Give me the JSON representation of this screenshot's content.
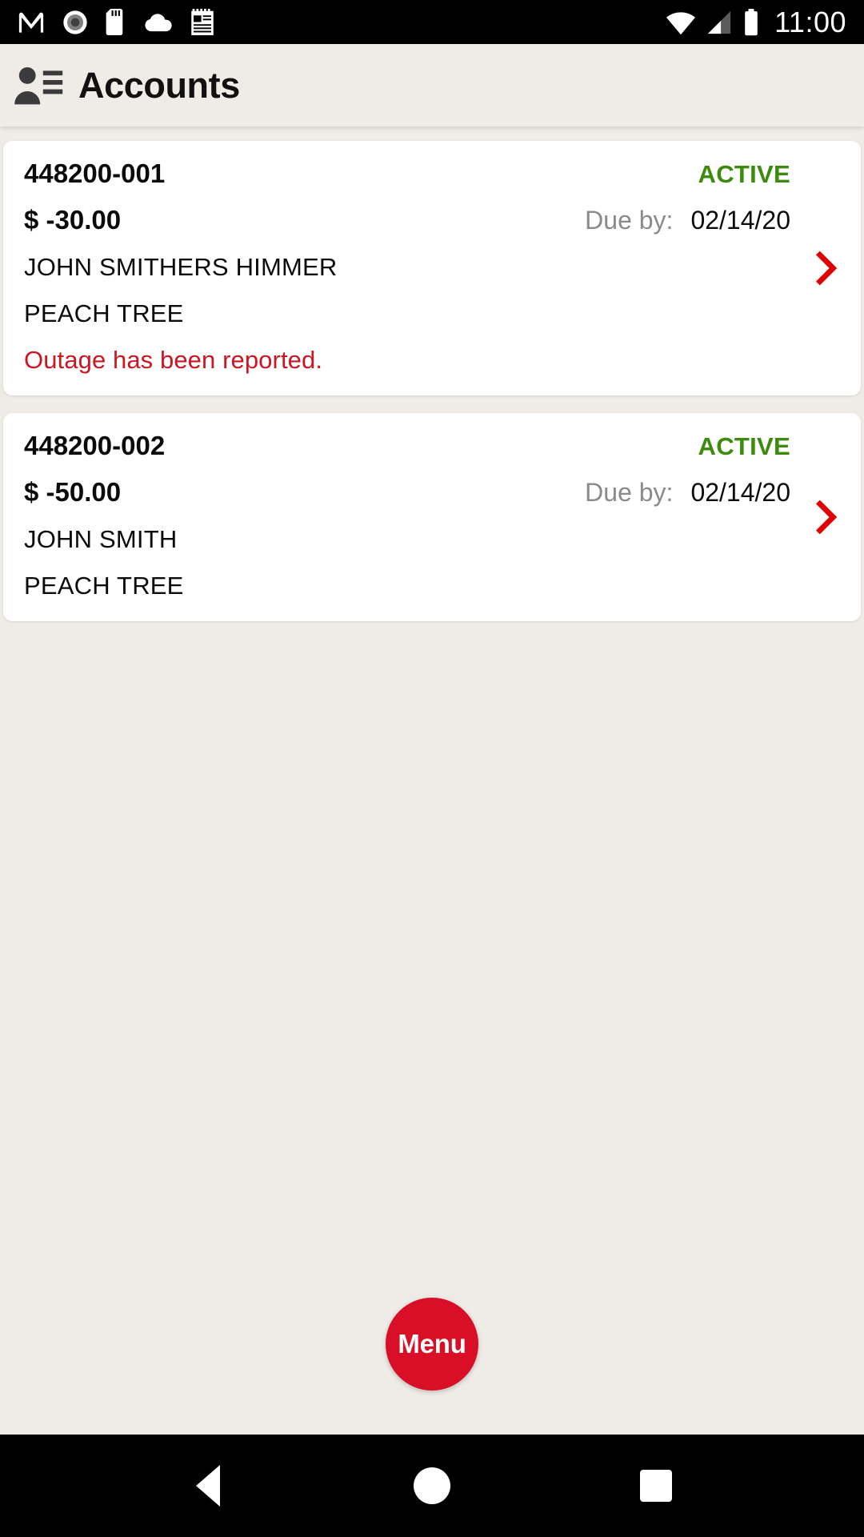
{
  "status_bar": {
    "icons": [
      "gmail-icon",
      "record-icon",
      "sd-card-icon",
      "cloud-icon",
      "notepad-icon"
    ],
    "wifi": "wifi-icon",
    "signal": "cellular-signal-icon",
    "battery": "battery-full-icon",
    "time": "11:00"
  },
  "header": {
    "icon": "contacts-icon",
    "title": "Accounts"
  },
  "accounts": [
    {
      "number": "448200-001",
      "status": "ACTIVE",
      "amount": "$ -30.00",
      "due_label": "Due by:",
      "due_date": "02/14/20",
      "name": "JOHN SMITHERS HIMMER",
      "location": "PEACH TREE",
      "alert": "Outage has been reported.",
      "chevron": "chevron-right-icon"
    },
    {
      "number": "448200-002",
      "status": "ACTIVE",
      "amount": "$ -50.00",
      "due_label": "Due by:",
      "due_date": "02/14/20",
      "name": "JOHN SMITH",
      "location": "PEACH TREE",
      "alert": "",
      "chevron": "chevron-right-icon"
    }
  ],
  "fab": {
    "label": "Menu"
  },
  "nav_bar": {
    "back": "back-triangle-icon",
    "home": "home-circle-icon",
    "recents": "recents-square-icon"
  },
  "colors": {
    "background": "#efebe7",
    "card": "#ffffff",
    "status_active": "#3c8b0c",
    "alert_red": "#cc1622",
    "chevron_red": "#e00000",
    "fab_red": "#d80f26",
    "muted_text": "#8a8a8a"
  }
}
